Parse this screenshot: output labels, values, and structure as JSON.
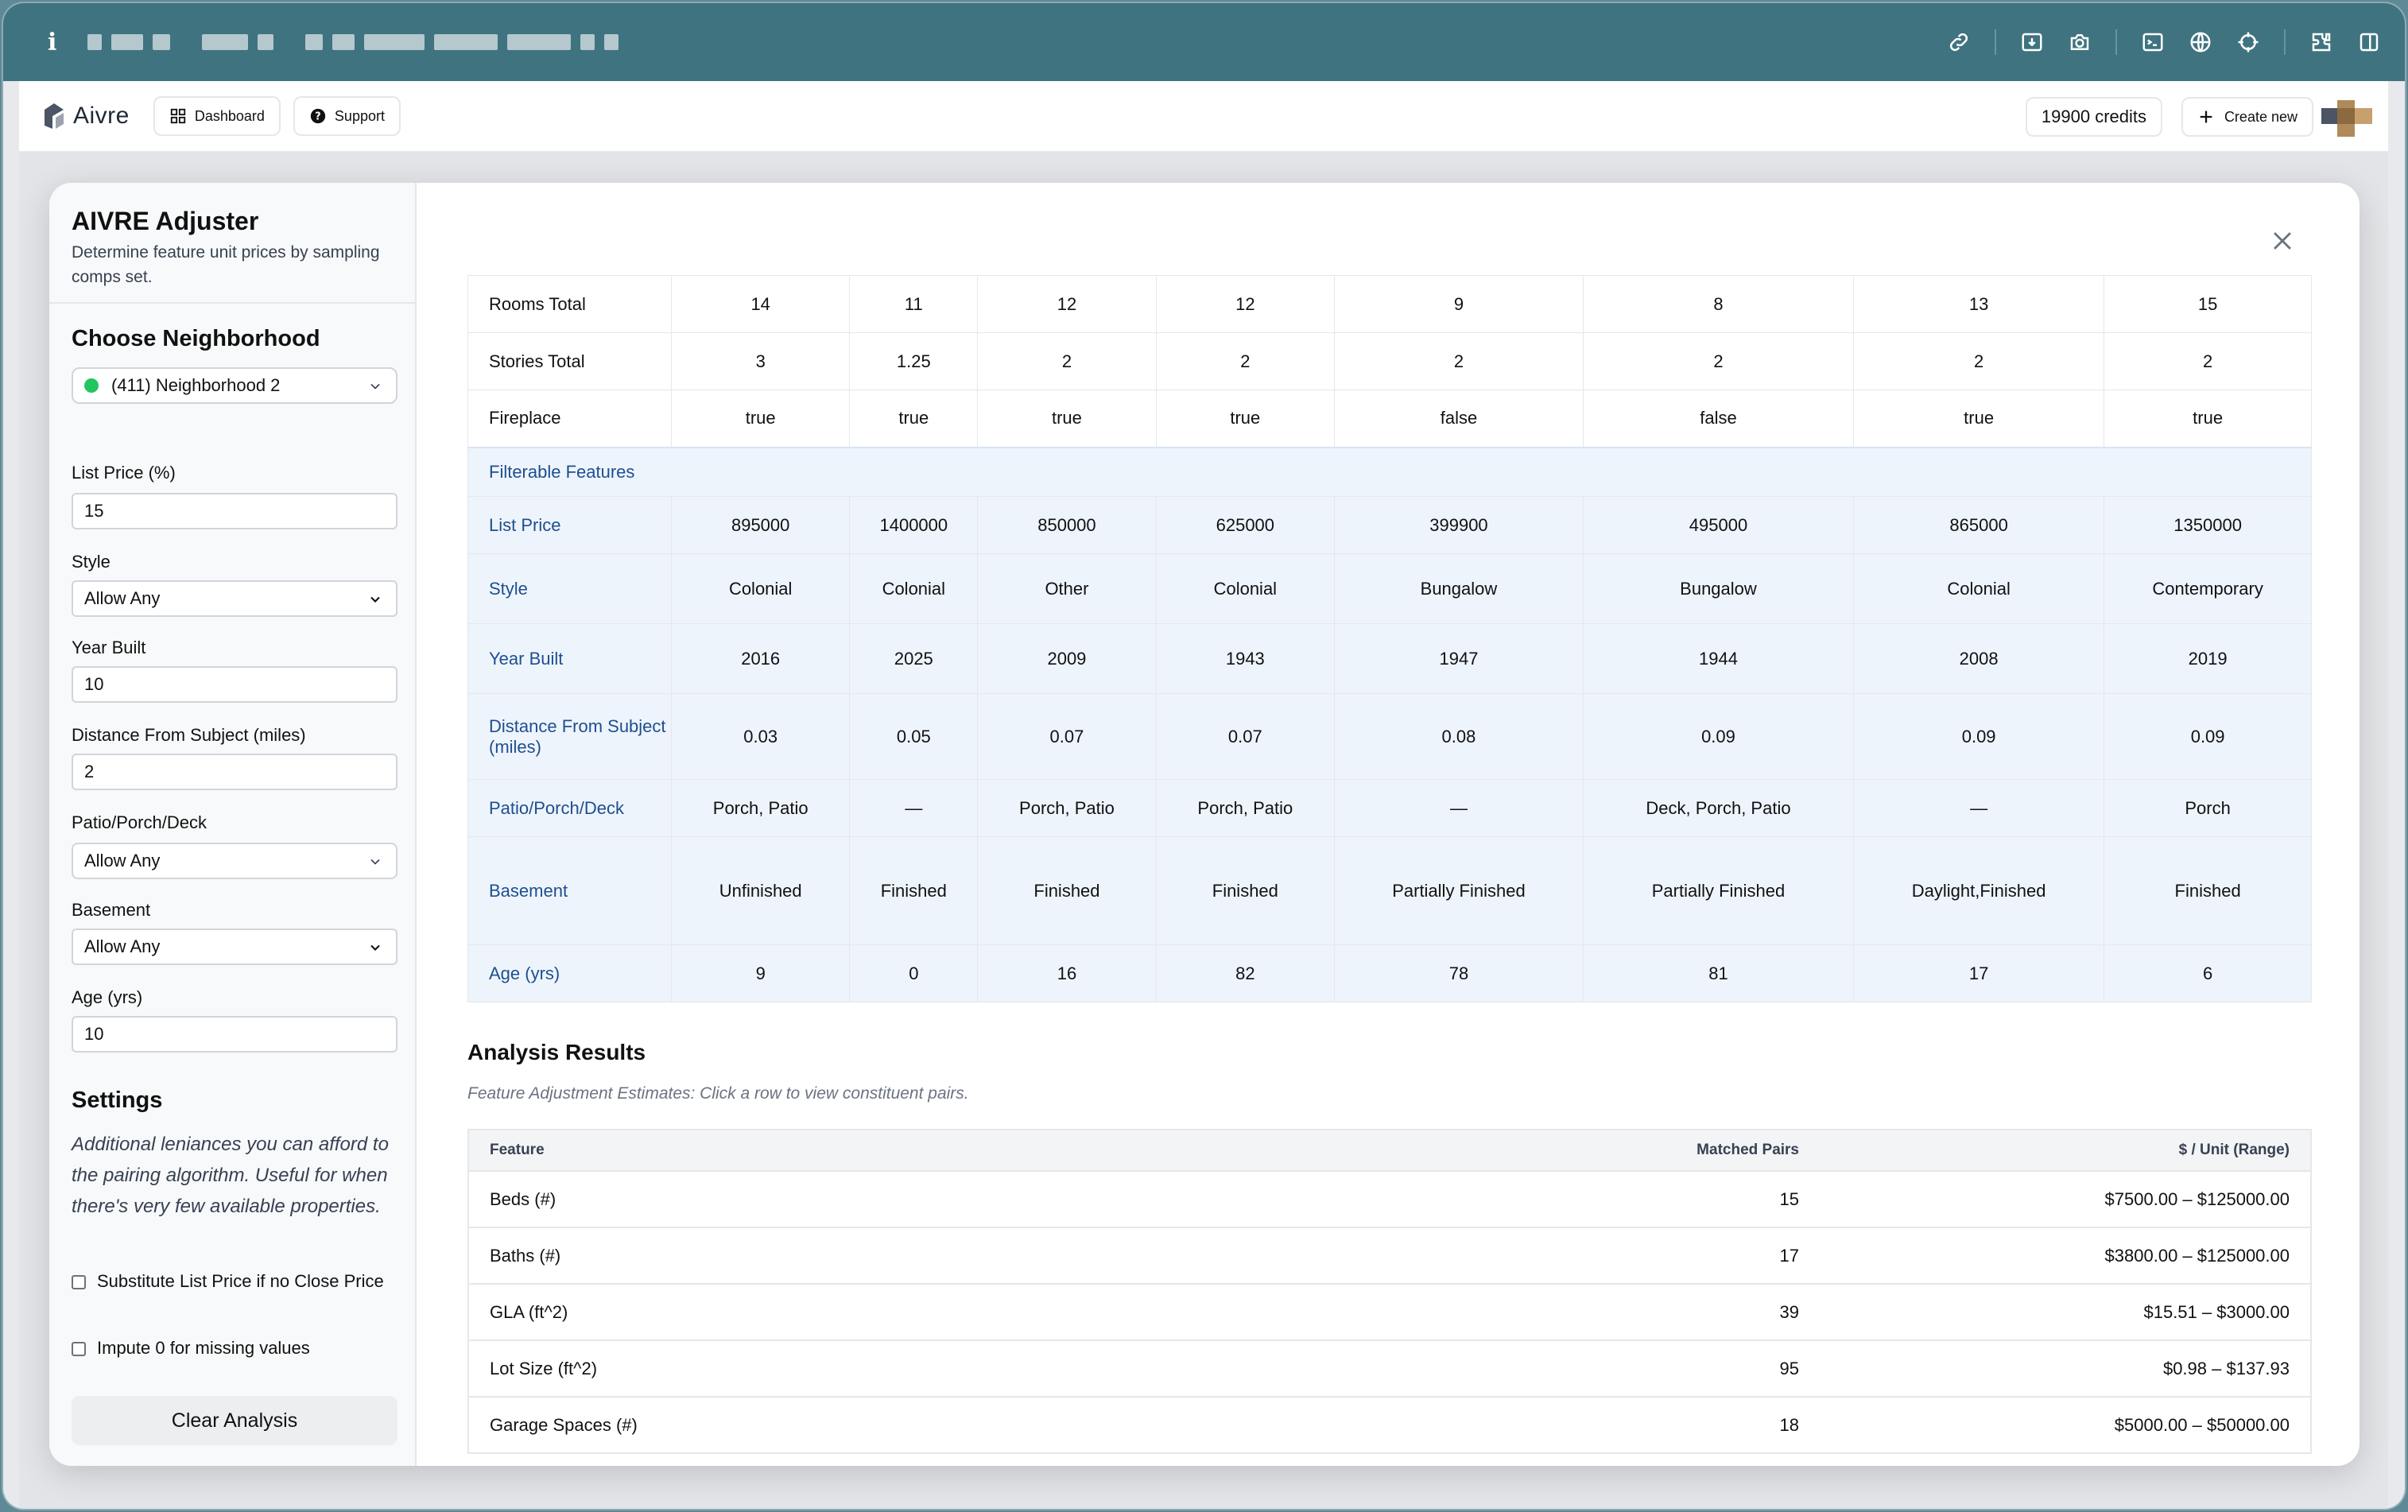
{
  "browser": {
    "info_glyph": "i",
    "toolbar_icons": [
      "link-icon",
      "download-icon",
      "camera-icon",
      "terminal-icon",
      "globe-icon",
      "crosshair-icon",
      "extension-icon",
      "sidebar-icon"
    ]
  },
  "app": {
    "logo_text": "Aivre",
    "nav": [
      {
        "label": "Dashboard",
        "icon": "grid-icon"
      },
      {
        "label": "Support",
        "icon": "question-circle-icon"
      }
    ],
    "credits": "19900 credits",
    "create_label": "Create new"
  },
  "sidebar": {
    "title": "AIVRE Adjuster",
    "subtitle": "Determine feature unit prices by sampling comps set.",
    "neighborhood_heading": "Choose Neighborhood",
    "neighborhood_value": "(411) Neighborhood 2",
    "filters": {
      "list_price_label": "List Price (%)",
      "list_price_value": "15",
      "style_label": "Style",
      "style_value": "Allow Any",
      "year_built_label": "Year Built",
      "year_built_value": "10",
      "distance_label": "Distance From Subject (miles)",
      "distance_value": "2",
      "patio_label": "Patio/Porch/Deck",
      "patio_value": "Allow Any",
      "basement_label": "Basement",
      "basement_value": "Allow Any",
      "age_label": "Age (yrs)",
      "age_value": "10"
    },
    "settings_heading": "Settings",
    "settings_help": "Additional leniances you can afford to the pairing algorithm. Useful for when there's very few available properties.",
    "check_substitute": "Substitute List Price if no Close Price",
    "check_impute": "Impute 0 for missing values",
    "clear_button": "Clear Analysis"
  },
  "features_table": {
    "plain_rows": [
      {
        "label": "Rooms Total",
        "values": [
          "14",
          "11",
          "12",
          "12",
          "9",
          "8",
          "13",
          "15"
        ]
      },
      {
        "label": "Stories Total",
        "values": [
          "3",
          "1.25",
          "2",
          "2",
          "2",
          "2",
          "2",
          "2"
        ]
      },
      {
        "label": "Fireplace",
        "values": [
          "true",
          "true",
          "true",
          "true",
          "false",
          "false",
          "true",
          "true"
        ]
      }
    ],
    "section_label": "Filterable Features",
    "filter_rows": [
      {
        "label": "List Price",
        "values": [
          "895000",
          "1400000",
          "850000",
          "625000",
          "399900",
          "495000",
          "865000",
          "1350000"
        ]
      },
      {
        "label": "Style",
        "values": [
          "Colonial",
          "Colonial",
          "Other",
          "Colonial",
          "Bungalow",
          "Bungalow",
          "Colonial",
          "Contemporary"
        ]
      },
      {
        "label": "Year Built",
        "values": [
          "2016",
          "2025",
          "2009",
          "1943",
          "1947",
          "1944",
          "2008",
          "2019"
        ]
      },
      {
        "label": "Distance From Subject (miles)",
        "values": [
          "0.03",
          "0.05",
          "0.07",
          "0.07",
          "0.08",
          "0.09",
          "0.09",
          "0.09"
        ]
      },
      {
        "label": "Patio/Porch/Deck",
        "values": [
          "Porch, Patio",
          "—",
          "Porch, Patio",
          "Porch, Patio",
          "—",
          "Deck, Porch, Patio",
          "—",
          "Porch"
        ]
      },
      {
        "label": "Basement",
        "values": [
          "Unfinished",
          "Finished",
          "Finished",
          "Finished",
          "Partially Finished",
          "Partially Finished",
          "Daylight,Finished",
          "Finished"
        ]
      },
      {
        "label": "Age (yrs)",
        "values": [
          "9",
          "0",
          "16",
          "82",
          "78",
          "81",
          "17",
          "6"
        ]
      }
    ]
  },
  "analysis": {
    "title": "Analysis Results",
    "subtitle": "Feature Adjustment Estimates: Click a row to view constituent pairs.",
    "headers": [
      "Feature",
      "Matched Pairs",
      "$ / Unit (Range)"
    ],
    "rows": [
      {
        "feature": "Beds (#)",
        "pairs": "15",
        "range": "$7500.00 – $125000.00"
      },
      {
        "feature": "Baths (#)",
        "pairs": "17",
        "range": "$3800.00 – $125000.00"
      },
      {
        "feature": "GLA (ft^2)",
        "pairs": "39",
        "range": "$15.51 – $3000.00"
      },
      {
        "feature": "Lot Size (ft^2)",
        "pairs": "95",
        "range": "$0.98 – $137.93"
      },
      {
        "feature": "Garage Spaces (#)",
        "pairs": "18",
        "range": "$5000.00 – $50000.00"
      }
    ]
  }
}
